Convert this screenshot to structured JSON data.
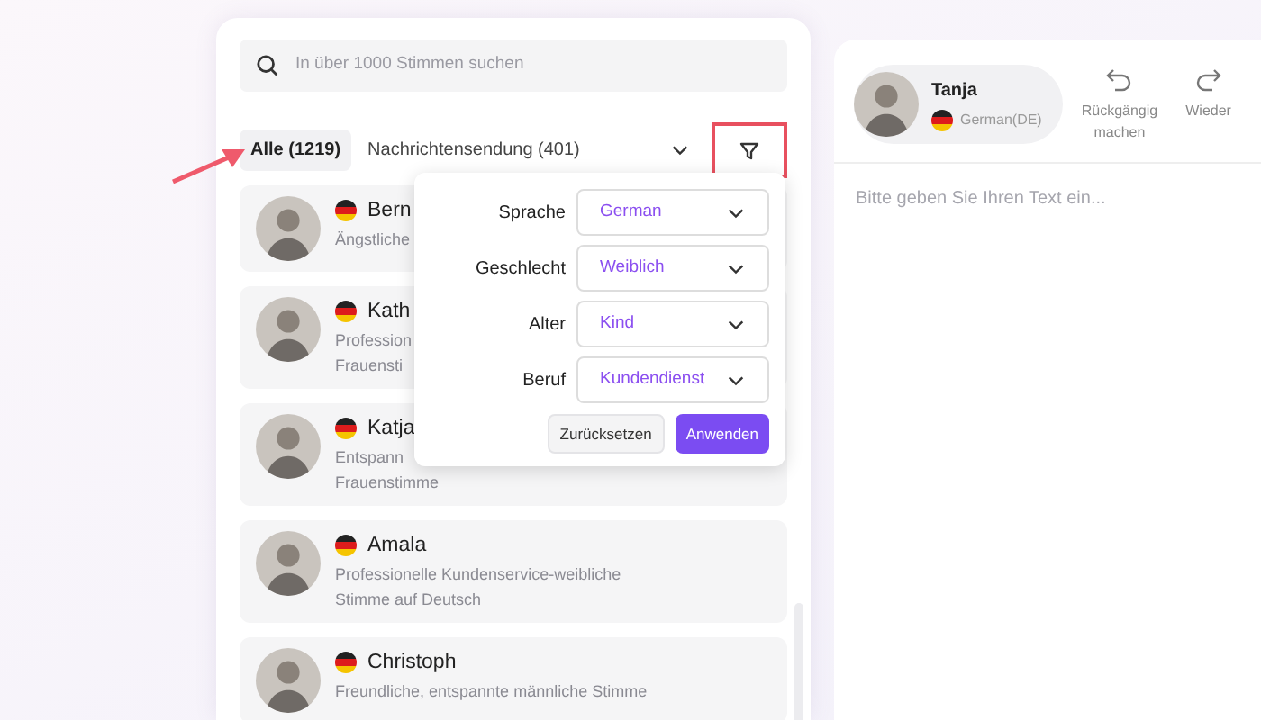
{
  "search": {
    "placeholder": "In über 1000 Stimmen suchen"
  },
  "tabs": [
    {
      "label": "Alle (1219)",
      "selected": true
    },
    {
      "label": "Nachrichtensendung (401)",
      "selected": false
    }
  ],
  "filter_button": {
    "highlighted": true
  },
  "voices": [
    {
      "name": "Bern",
      "description": [
        "Ängstliche"
      ]
    },
    {
      "name": "Kath",
      "description": [
        "Profession",
        "Frauensti"
      ]
    },
    {
      "name": "Katja",
      "description": [
        "Entspann",
        "Frauenstimme"
      ]
    },
    {
      "name": "Amala",
      "description": [
        "Professionelle Kundenservice-weibliche",
        "Stimme auf Deutsch"
      ]
    },
    {
      "name": "Christoph",
      "description": [
        "Freundliche, entspannte männliche Stimme"
      ]
    }
  ],
  "filter_popup": {
    "fields": [
      {
        "label": "Sprache",
        "value": "German"
      },
      {
        "label": "Geschlecht",
        "value": "Weiblich"
      },
      {
        "label": "Alter",
        "value": "Kind"
      },
      {
        "label": "Beruf",
        "value": "Kundendienst"
      }
    ],
    "buttons": [
      {
        "label": "Zurücksetzen",
        "kind": "secondary"
      },
      {
        "label": "Anwenden",
        "kind": "primary"
      }
    ]
  },
  "editor": {
    "voice": {
      "name": "Tanja",
      "language": "German(DE)"
    },
    "actions": [
      {
        "label": "Rückgängig machen",
        "kind": "undo"
      },
      {
        "label": "Wieder",
        "kind": "redo"
      }
    ],
    "placeholder": "Bitte geben Sie Ihren Text ein..."
  }
}
